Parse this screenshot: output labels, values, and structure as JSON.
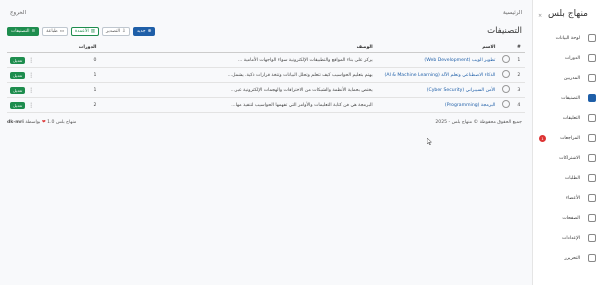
{
  "topbar": {
    "breadcrumb": "الرئيسية",
    "logout": "الخروج"
  },
  "page_title": "التصنيفات",
  "toolbar": {
    "add": "جديد",
    "categories": "التصنيفات",
    "print": "طباعة",
    "columns": "الأعمدة",
    "export": "التصدير"
  },
  "table": {
    "headers": {
      "num": "#",
      "name": "الاسم",
      "desc": "الوصف",
      "count": "الدورات"
    },
    "edit_label": "تعديل",
    "rows": [
      {
        "num": "1",
        "name": "تطوير الويب (Web Development)",
        "desc": "يركز على بناء المواقع والتطبيقات الإلكترونية سواء الواجهات الأمامية ...",
        "count": "0"
      },
      {
        "num": "2",
        "name": "الذكاء الاصطناعي وتعلم الآلة (AI & Machine Learning)",
        "desc": "يهتم بتعليم الحواسيب كيف تتعلم وتحلل البيانات وتتخذ قرارات ذكية. يشمل...",
        "count": "1"
      },
      {
        "num": "3",
        "name": "الأمن السيبراني (Cyber Security)",
        "desc": "يختص بحماية الأنظمة والشبكات من الاختراقات والهجمات الإلكترونية عبر...",
        "count": "1"
      },
      {
        "num": "4",
        "name": "البرمجة (Programming)",
        "desc": "البرمجة هي فن كتابة التعليمات والأوامر التي تفهمها الحواسيب لتنفيذ مها...",
        "count": "2"
      }
    ]
  },
  "footer": {
    "copyright": "جميع الحقوق محفوظة © منهاج بلس - 2025",
    "version_text": "منهاج بلس 1.0",
    "by_text": "بواسطة",
    "author": "dk-mri"
  },
  "sidebar": {
    "logo": "منهاج بلس",
    "close": "×",
    "items": [
      {
        "label": "لوحة البيانات",
        "icon": "dashboard-icon",
        "badge": ""
      },
      {
        "label": "الدورات",
        "icon": "courses-icon",
        "badge": ""
      },
      {
        "label": "المدربين",
        "icon": "instructors-icon",
        "badge": ""
      },
      {
        "label": "التصنيفات",
        "icon": "categories-icon",
        "badge": ""
      },
      {
        "label": "التعليقات",
        "icon": "comments-icon",
        "badge": ""
      },
      {
        "label": "المراجعات",
        "icon": "reviews-icon",
        "badge": "1"
      },
      {
        "label": "الاشتراكات",
        "icon": "subscriptions-icon",
        "badge": ""
      },
      {
        "label": "الطلبات",
        "icon": "orders-icon",
        "badge": ""
      },
      {
        "label": "الأعضاء",
        "icon": "members-icon",
        "badge": ""
      },
      {
        "label": "الصفحات",
        "icon": "pages-icon",
        "badge": ""
      },
      {
        "label": "الإعدادات",
        "icon": "settings-icon",
        "badge": ""
      },
      {
        "label": "التحريرر",
        "icon": "editor-icon",
        "badge": ""
      }
    ]
  },
  "colors": {
    "primary": "#1f5fa8",
    "success": "#1e8d4e",
    "danger": "#dd3333"
  }
}
